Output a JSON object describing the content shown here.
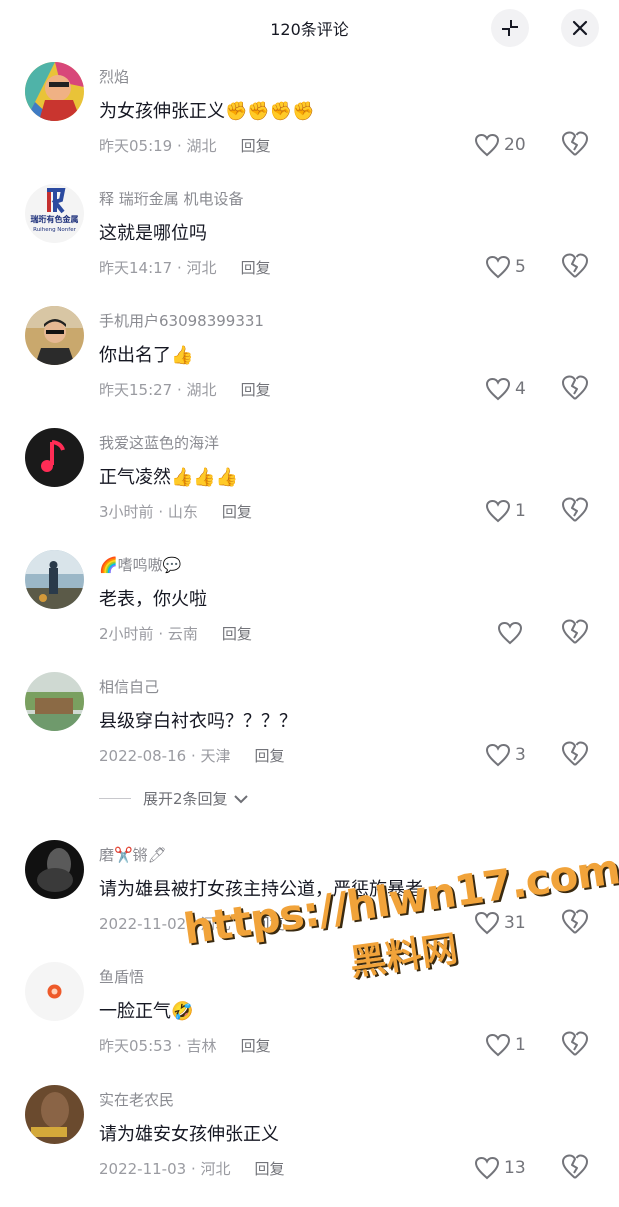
{
  "header": {
    "title": "120条评论"
  },
  "comments": [
    {
      "user": "烈焰",
      "text": "为女孩伸张正义✊✊✊✊",
      "time": "昨天05:19",
      "location": "湖北",
      "reply": "回复",
      "likes": "20"
    },
    {
      "user": "释 瑞珩金属  机电设备",
      "text": "这就是哪位吗",
      "time": "昨天14:17",
      "location": "河北",
      "reply": "回复",
      "likes": "5",
      "avatar_text": "瑞珩有色金属",
      "avatar_subtext": "Ruiheng Nonfer"
    },
    {
      "user": "手机用户63098399331",
      "text": "你出名了👍",
      "time": "昨天15:27",
      "location": "湖北",
      "reply": "回复",
      "likes": "4"
    },
    {
      "user": "我爱这蓝色的海洋",
      "text": "正气凌然👍👍👍",
      "time": "3小时前",
      "location": "山东",
      "reply": "回复",
      "likes": "1"
    },
    {
      "user": "🌈嗜鸣嗷💬",
      "text": "老表，你火啦",
      "time": "2小时前",
      "location": "云南",
      "reply": "回复",
      "likes": ""
    },
    {
      "user": "相信自己",
      "text": "县级穿白衬衣吗？？？？",
      "time": "2022-08-16",
      "location": "天津",
      "reply": "回复",
      "likes": "3"
    },
    {
      "user": "磨✂️锵🖊",
      "text": "请为雄县被打女孩主持公道，严惩施暴者",
      "time": "2022-11-02",
      "location": "河北",
      "reply": "回复",
      "likes": "31"
    },
    {
      "user": "鱼盾悟",
      "text": "一脸正气🤣",
      "time": "昨天05:53",
      "location": "吉林",
      "reply": "回复",
      "likes": "1"
    },
    {
      "user": "实在老农民",
      "text": "请为雄安女孩伸张正义",
      "time": "2022-11-03",
      "location": "河北",
      "reply": "回复",
      "likes": "13"
    }
  ],
  "expand_replies": "展开2条回复",
  "watermark": {
    "url": "https://hlwn17.com",
    "name": "黑料网"
  },
  "colors": {
    "text": "#161823",
    "meta": "#9a9ba1",
    "watermark": "#f1a33a"
  }
}
